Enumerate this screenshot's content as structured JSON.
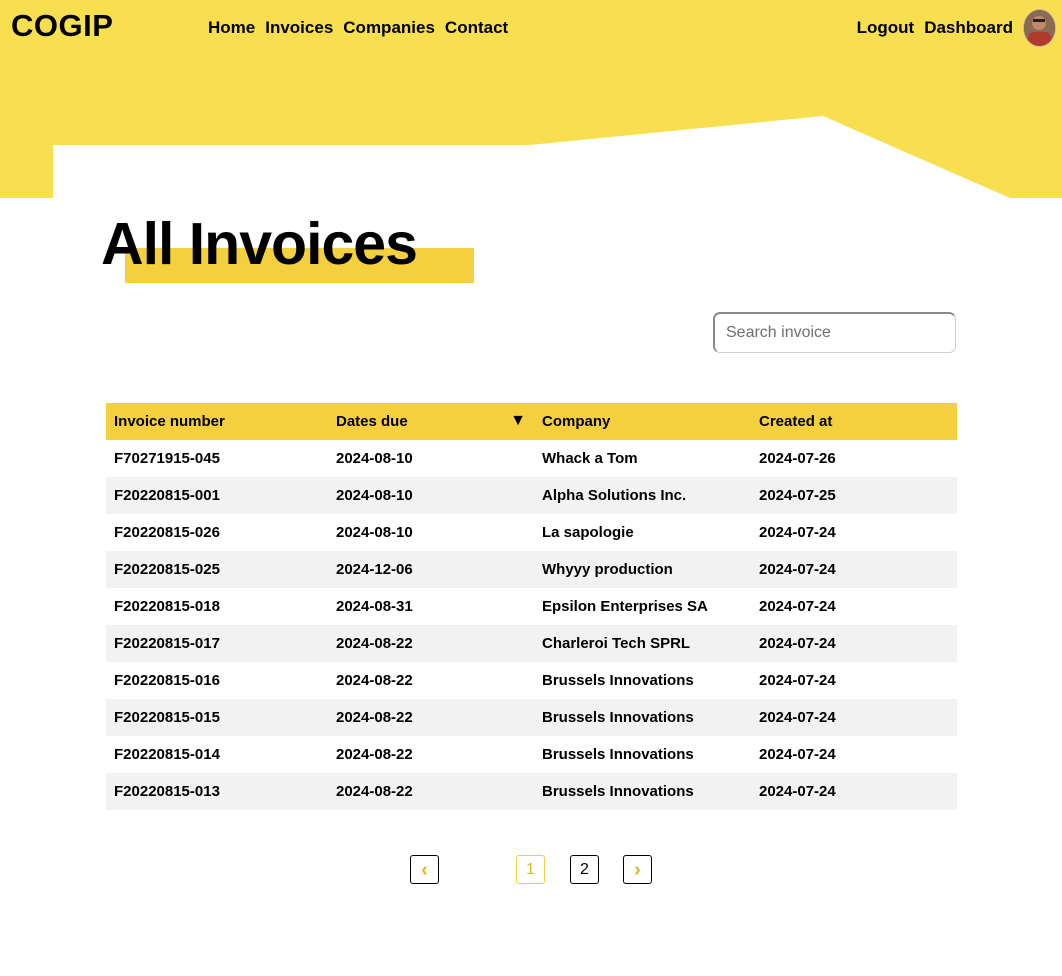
{
  "brand": {
    "logo": "COGIP",
    "accent": "#f4d03f",
    "hero_bg": "#f8df4f"
  },
  "nav": {
    "items": [
      "Home",
      "Invoices",
      "Companies",
      "Contact"
    ]
  },
  "user_nav": {
    "logout": "Logout",
    "dashboard": "Dashboard",
    "avatar_icon": "user-avatar-icon"
  },
  "page": {
    "title": "All Invoices"
  },
  "search": {
    "placeholder": "Search invoice",
    "value": ""
  },
  "table": {
    "headers": [
      "Invoice number",
      "Dates due",
      "Company",
      "Created at"
    ],
    "sort_icon": "sort-down-icon",
    "rows": [
      [
        "F70271915-045",
        "2024-08-10",
        "Whack a Tom",
        "2024-07-26"
      ],
      [
        "F20220815-001",
        "2024-08-10",
        "Alpha Solutions Inc.",
        "2024-07-25"
      ],
      [
        "F20220815-026",
        "2024-08-10",
        "La sapologie",
        "2024-07-24"
      ],
      [
        "F20220815-025",
        "2024-12-06",
        "Whyyy production",
        "2024-07-24"
      ],
      [
        "F20220815-018",
        "2024-08-31",
        "Epsilon Enterprises SA",
        "2024-07-24"
      ],
      [
        "F20220815-017",
        "2024-08-22",
        "Charleroi Tech SPRL",
        "2024-07-24"
      ],
      [
        "F20220815-016",
        "2024-08-22",
        "Brussels Innovations",
        "2024-07-24"
      ],
      [
        "F20220815-015",
        "2024-08-22",
        "Brussels Innovations",
        "2024-07-24"
      ],
      [
        "F20220815-014",
        "2024-08-22",
        "Brussels Innovations",
        "2024-07-24"
      ],
      [
        "F20220815-013",
        "2024-08-22",
        "Brussels Innovations",
        "2024-07-24"
      ]
    ]
  },
  "pagination": {
    "pages": [
      "1",
      "2"
    ],
    "current": "1",
    "prev_icon": "chevron-left-icon",
    "next_icon": "chevron-right-icon"
  }
}
